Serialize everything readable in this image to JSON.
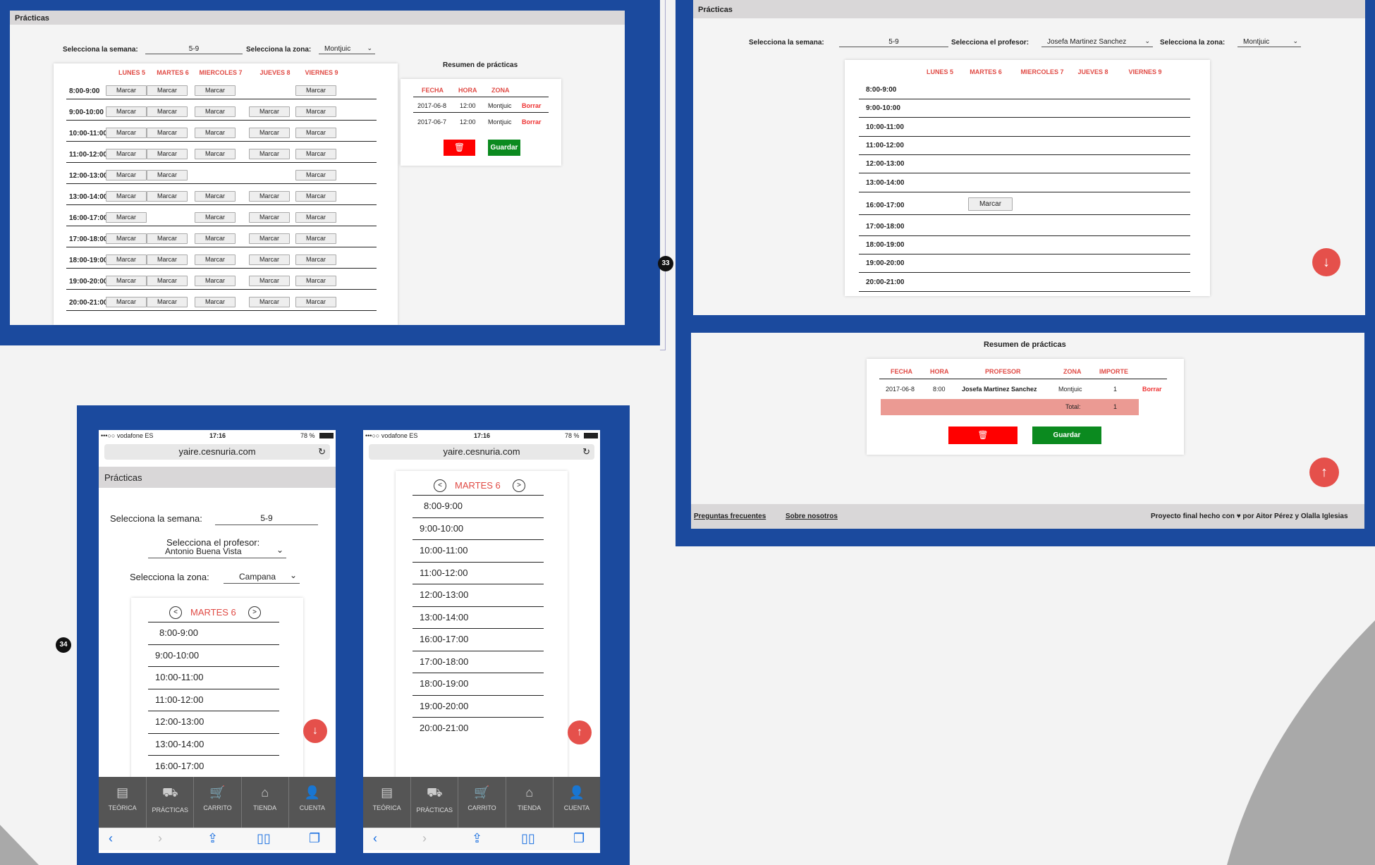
{
  "page_title": "Prácticas",
  "week_label": "Selecciona la semana:",
  "week_value": "5-9",
  "zone_label": "Selecciona la zona:",
  "teacher_label": "Selecciona el profesor:",
  "marcar": "Marcar",
  "days": [
    "LUNES 5",
    "MARTES 6",
    "MIERCOLES 7",
    "JUEVES 8",
    "VIERNES 9"
  ],
  "times": [
    "8:00-9:00",
    "9:00-10:00",
    "10:00-11:00",
    "11:00-12:00",
    "12:00-13:00",
    "13:00-14:00",
    "16:00-17:00",
    "17:00-18:00",
    "18:00-19:00",
    "19:00-20:00",
    "20:00-21:00"
  ],
  "desktop1": {
    "zone_value": "Montjuic",
    "availability": [
      [
        1,
        1,
        1,
        0,
        1
      ],
      [
        1,
        1,
        1,
        1,
        1
      ],
      [
        1,
        1,
        1,
        1,
        1
      ],
      [
        1,
        1,
        1,
        1,
        1
      ],
      [
        1,
        1,
        0,
        0,
        1
      ],
      [
        1,
        1,
        1,
        1,
        1
      ],
      [
        1,
        0,
        1,
        1,
        1
      ],
      [
        1,
        1,
        1,
        1,
        1
      ],
      [
        1,
        1,
        1,
        1,
        1
      ],
      [
        1,
        1,
        1,
        1,
        1
      ],
      [
        1,
        1,
        1,
        1,
        1
      ]
    ],
    "summary_title": "Resumen de prácticas",
    "summary_headers": [
      "FECHA",
      "HORA",
      "ZONA"
    ],
    "summary_rows": [
      {
        "fecha": "2017-06-8",
        "hora": "12:00",
        "zona": "Montjuic",
        "action": "Borrar"
      },
      {
        "fecha": "2017-06-7",
        "hora": "12:00",
        "zona": "Montjuic",
        "action": "Borrar"
      }
    ],
    "save_label": "Guardar"
  },
  "desktop2": {
    "teacher_value": "Josefa Martinez Sanchez",
    "zone_value": "Montjuic",
    "marcar_slot": {
      "time_index": 6,
      "day_index": 1
    }
  },
  "desktop3": {
    "summary_title": "Resumen de prácticas",
    "headers": [
      "FECHA",
      "HORA",
      "PROFESOR",
      "ZONA",
      "IMPORTE"
    ],
    "row": {
      "fecha": "2017-06-8",
      "hora": "8:00",
      "profesor": "Josefa Martinez Sanchez",
      "zona": "Montjuic",
      "importe": "1",
      "action": "Borrar"
    },
    "total_label": "Total:",
    "total_value": "1",
    "save_label": "Guardar",
    "footer_links": [
      "Preguntas frecuentes",
      "Sobre nosotros"
    ],
    "footer_credit_pre": "Proyecto final hecho con",
    "footer_credit_post": "por Aitor Pérez y Olalla Iglesias"
  },
  "badges": {
    "b33": "33",
    "b34": "34"
  },
  "mobile": {
    "carrier": "•••○○ vodafone ES",
    "time": "17:16",
    "battery": "78 %",
    "url": "yaire.cesnuria.com",
    "teacher_value": "Antonio Buena Vista",
    "zone_value": "Campana",
    "day": "MARTES 6",
    "prev": "<",
    "next": ">",
    "tabs": [
      {
        "label": "TEÓRICA",
        "icon": "▤"
      },
      {
        "label": "PRÁCTICAS",
        "icon": "⛟"
      },
      {
        "label": "CARRITO",
        "icon": "🛒"
      },
      {
        "label": "TIENDA",
        "icon": "⌂"
      },
      {
        "label": "CUENTA",
        "icon": "👤"
      }
    ]
  },
  "colors": {
    "frame_blue": "#1b4a9e",
    "accent_red": "#e5504b",
    "delete_red": "#ff0000",
    "save_green": "#0b8a1f",
    "total_row": "#eb9a93"
  }
}
